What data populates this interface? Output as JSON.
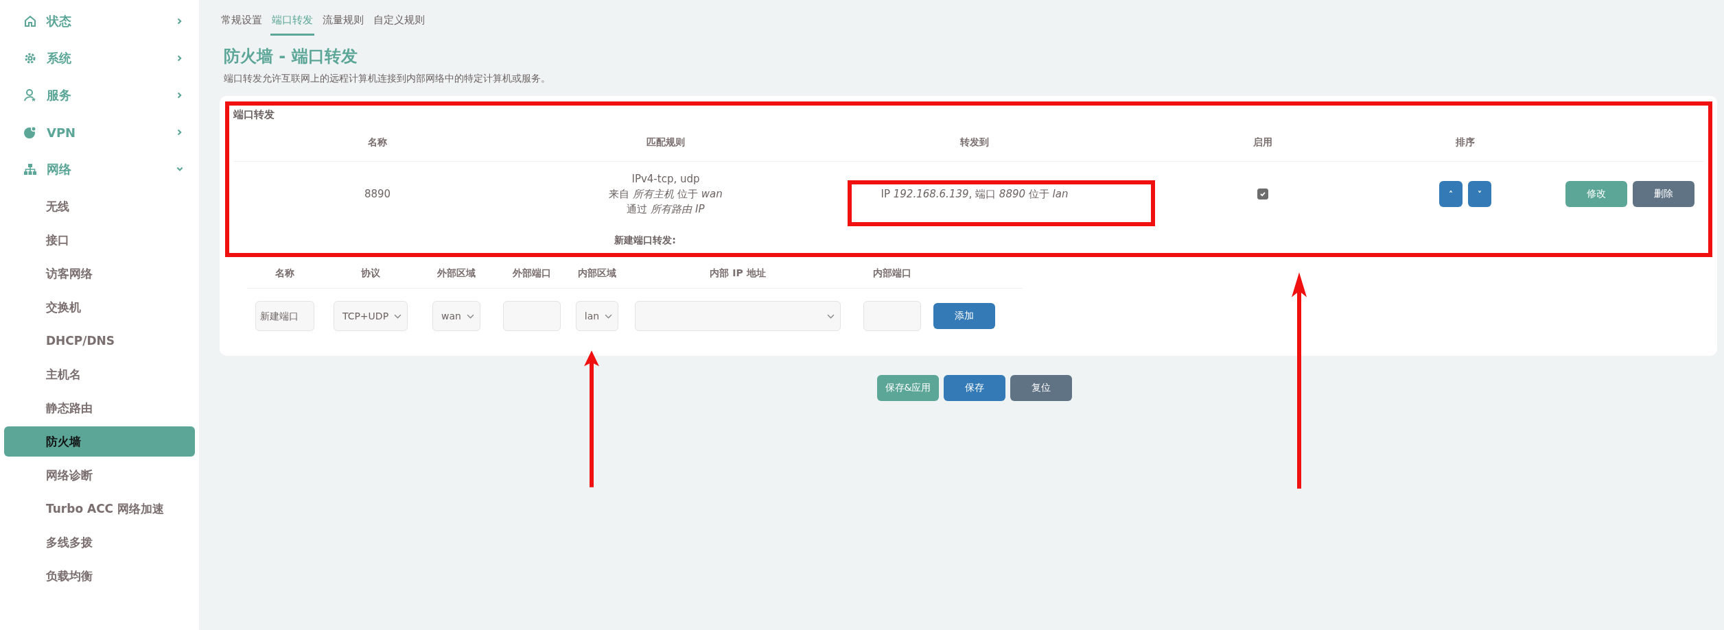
{
  "sidebar": {
    "items": [
      {
        "label": "状态",
        "expanded": false
      },
      {
        "label": "系统",
        "expanded": false
      },
      {
        "label": "服务",
        "expanded": false
      },
      {
        "label": "VPN",
        "expanded": false
      },
      {
        "label": "网络",
        "expanded": true,
        "children": [
          {
            "label": "无线",
            "selected": false
          },
          {
            "label": "接口",
            "selected": false
          },
          {
            "label": "访客网络",
            "selected": false
          },
          {
            "label": "交换机",
            "selected": false
          },
          {
            "label": "DHCP/DNS",
            "selected": false
          },
          {
            "label": "主机名",
            "selected": false
          },
          {
            "label": "静态路由",
            "selected": false
          },
          {
            "label": "防火墙",
            "selected": true
          },
          {
            "label": "网络诊断",
            "selected": false
          },
          {
            "label": "Turbo ACC 网络加速",
            "selected": false
          },
          {
            "label": "多线多拨",
            "selected": false
          },
          {
            "label": "负载均衡",
            "selected": false
          }
        ]
      }
    ]
  },
  "tabs": [
    {
      "label": "常规设置",
      "selected": false
    },
    {
      "label": "端口转发",
      "selected": true
    },
    {
      "label": "流量规则",
      "selected": false
    },
    {
      "label": "自定义规则",
      "selected": false
    }
  ],
  "title": "防火墙 - 端口转发",
  "description": "端口转发允许互联网上的远程计算机连接到内部网络中的特定计算机或服务。",
  "section": {
    "title": "端口转发",
    "columns": [
      "名称",
      "匹配规则",
      "转发到",
      "启用",
      "排序"
    ],
    "rows": [
      {
        "name": "8890",
        "match": [
          "IPv4-tcp, udp",
          "来自 *所有主机* 位于 *wan*",
          "通过 *所有路由 IP*"
        ],
        "forward": "IP *192.168.6.139*, 端口 *8890* 位于 *lan*",
        "enabled": true,
        "up": "˄",
        "down": "˅",
        "edit": "修改",
        "delete": "删除"
      }
    ],
    "new_title": "新建端口转发:",
    "form_columns": [
      "名称",
      "协议",
      "外部区域",
      "外部端口",
      "内部区域",
      "内部 IP 地址",
      "内部端口"
    ],
    "form": {
      "name_placeholder": "新建端口",
      "protocol": "TCP+UDP",
      "external_zone": "wan",
      "internal_zone": "lan",
      "add": "添加"
    }
  },
  "buttons": [
    {
      "label": "保存&应用",
      "kind": "apply"
    },
    {
      "label": "保存",
      "kind": "save"
    },
    {
      "label": "复位",
      "kind": "reset"
    }
  ],
  "annotations": [
    {
      "kind": "box"
    },
    {
      "kind": "box"
    },
    {
      "kind": "arrow"
    },
    {
      "kind": "arrow"
    }
  ]
}
